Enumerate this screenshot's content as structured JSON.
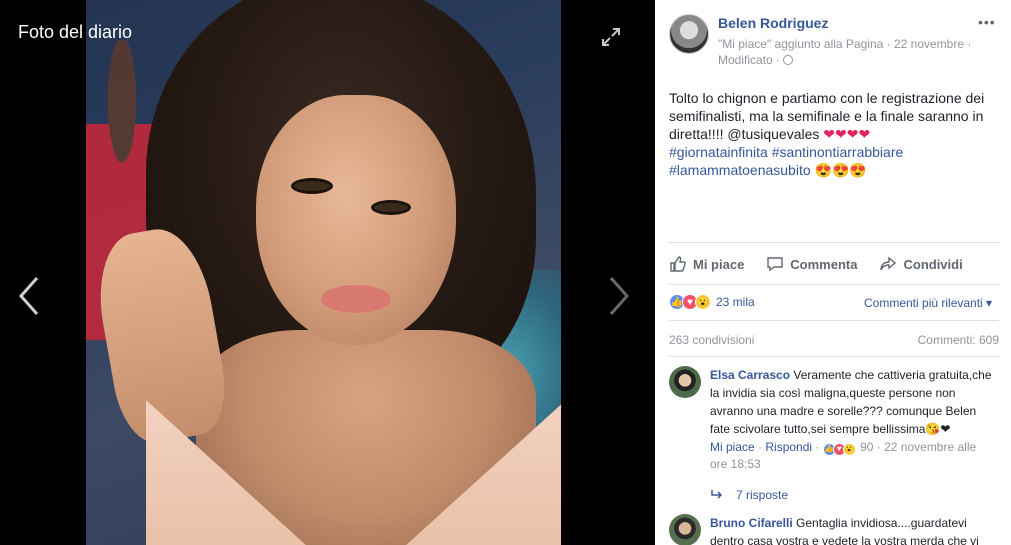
{
  "viewer": {
    "title": "Foto del diario",
    "expand_icon": "expand-icon",
    "prev_icon": "chevron-left-icon",
    "next_icon": "chevron-right-icon"
  },
  "post": {
    "author": "Belen Rodriguez",
    "meta_line1": "\"Mi piace\" aggiunto alla Pagina · 22 novembre ·",
    "meta_line2": "Modificato ·",
    "more": "•••",
    "text_main": "Tolto lo chignon e partiamo con le registrazione dei semifinalisti, ma la semifinale e la finale saranno in diretta!!!! @tusiquevales",
    "text_hearts": "❤❤❤❤",
    "hashtag1": "#giornatainfinita",
    "hashtag2": "#santinontiarrabbiare",
    "hashtag3": "#lamammatoenasubito",
    "text_emoji": "😍😍😍"
  },
  "actions": {
    "like": "Mi piace",
    "comment": "Commenta",
    "share": "Condividi"
  },
  "stats": {
    "reactions_count": "23 mila",
    "sort_label": "Commenti più rilevanti ▾",
    "shares": "263 condivisioni",
    "comments": "Commenti: 609"
  },
  "comments": [
    {
      "name": "Elsa Carrasco",
      "text": "Veramente che cattiveria gratuita,che la invidia sia così maligna,queste persone non avranno una madre e sorelle??? comunque Belen fate scivolare tutto,sei sempre bellissima😘❤",
      "like": "Mi piace",
      "reply": "Rispondi",
      "reaction_count": "90",
      "time": "22 novembre alle ore 18:53",
      "replies": "7 risposte"
    },
    {
      "name": "Bruno Cifarelli",
      "text": "Gentaglia invidiosa....guardatevi dentro casa vostra e vedete la vostra merda che vi"
    }
  ],
  "colors": {
    "link": "#365899",
    "muted": "#90949c",
    "divider": "#dddfe2"
  }
}
